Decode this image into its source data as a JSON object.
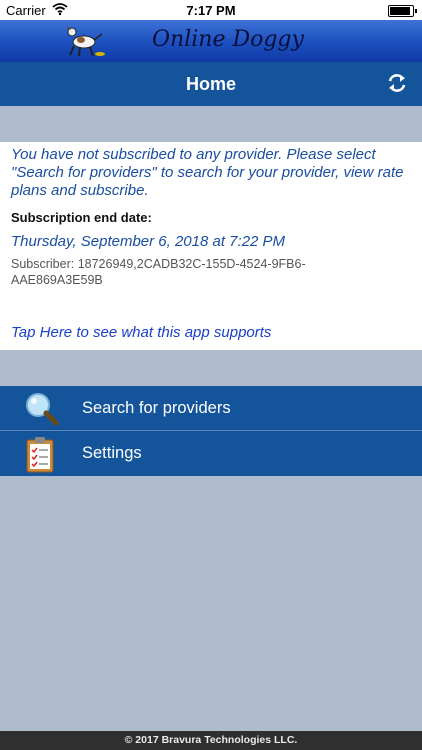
{
  "status_bar": {
    "carrier": "Carrier",
    "time": "7:17 PM"
  },
  "banner": {
    "title": "Online Doggy"
  },
  "nav": {
    "title": "Home"
  },
  "content": {
    "notice": "You have not subscribed to any provider. Please select \"Search for providers\" to search for your provider, view rate plans and subscribe.",
    "subscription_label": "Subscription end date:",
    "subscription_date": "Thursday, September 6, 2018 at 7:22 PM",
    "subscriber": "Subscriber: 18726949,2CADB32C-155D-4524-9FB6-AAE869A3E59B",
    "tap_link": "Tap Here to see what this app supports"
  },
  "menu": {
    "items": [
      {
        "label": "Search for providers",
        "icon": "magnifier-icon"
      },
      {
        "label": "Settings",
        "icon": "clipboard-icon"
      }
    ]
  },
  "footer": {
    "text": "© 2017 Bravura Technologies LLC."
  },
  "colors": {
    "nav_blue": "#14549b",
    "banner_blue": "#1c4fbf",
    "background": "#aebccd",
    "link_blue": "#1a4ea1",
    "footer": "#2f2f2f"
  }
}
